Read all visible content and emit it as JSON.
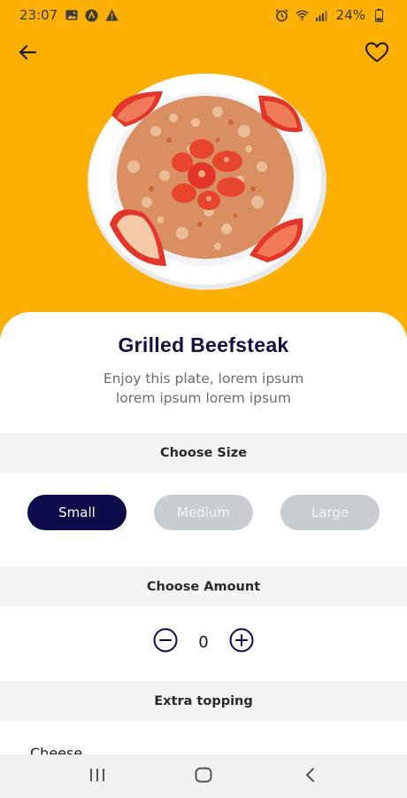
{
  "status_bar": {
    "time": "23:07",
    "battery_percent": "24%",
    "icons": [
      "gallery-icon",
      "app-notification-icon",
      "warning-icon",
      "alarm-icon",
      "wifi-icon",
      "signal-icon",
      "battery-icon"
    ]
  },
  "header": {
    "back_icon": "arrow-left-icon",
    "favorite_icon": "heart-outline-icon"
  },
  "colors": {
    "hero_background": "#fbb003",
    "primary_dark": "#0d0b4a",
    "inactive_chip": "#c9ccd0",
    "section_background": "#f3f4f6"
  },
  "product": {
    "name": "Grilled Beefsteak",
    "description_line1": "Enjoy this plate, lorem ipsum",
    "description_line2": "lorem ipsum lorem ipsum"
  },
  "size_section": {
    "heading": "Choose Size",
    "options": [
      {
        "label": "Small",
        "selected": true
      },
      {
        "label": "Medium",
        "selected": false
      },
      {
        "label": "Large",
        "selected": false
      }
    ]
  },
  "amount_section": {
    "heading": "Choose Amount",
    "value": "0",
    "decrement_icon": "minus-circle-icon",
    "increment_icon": "plus-circle-icon"
  },
  "topping_section": {
    "heading": "Extra topping",
    "items": [
      {
        "label": "Cheese"
      }
    ]
  },
  "system_nav": {
    "icons": [
      "recent-apps-icon",
      "home-icon",
      "back-icon"
    ]
  }
}
